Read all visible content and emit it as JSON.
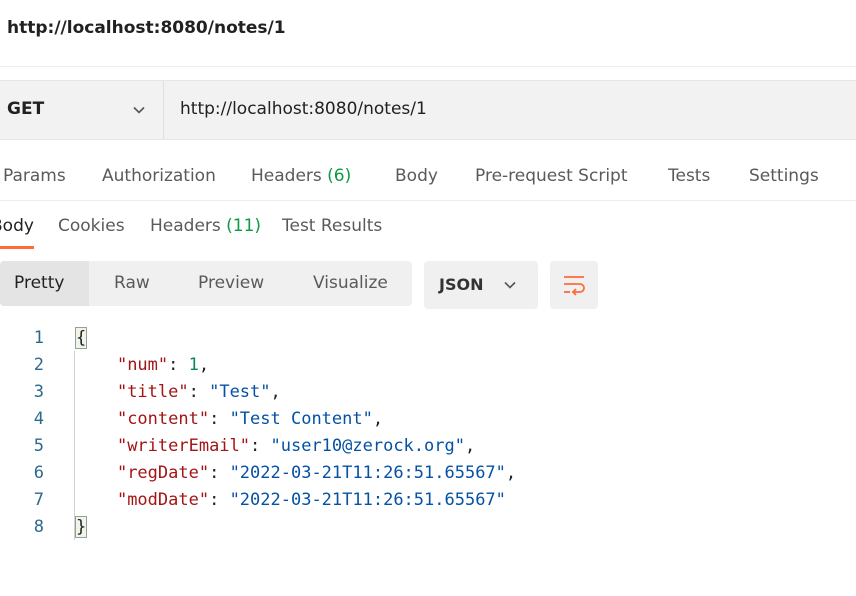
{
  "title": "http://localhost:8080/notes/1",
  "request": {
    "method": "GET",
    "url": "http://localhost:8080/notes/1"
  },
  "request_tabs": {
    "params": "Params",
    "authorization": "Authorization",
    "headers": "Headers",
    "headers_count": "(6)",
    "body": "Body",
    "prerequest": "Pre-request Script",
    "tests": "Tests",
    "settings": "Settings"
  },
  "response_tabs": {
    "body": "Body",
    "cookies": "Cookies",
    "headers": "Headers",
    "headers_count": "(11)",
    "test_results": "Test Results"
  },
  "view_modes": {
    "pretty": "Pretty",
    "raw": "Raw",
    "preview": "Preview",
    "visualize": "Visualize"
  },
  "format": "JSON",
  "colors": {
    "accent": "#ff6c37",
    "count": "#0c9a43"
  },
  "response_body": {
    "line_numbers": [
      "1",
      "2",
      "3",
      "4",
      "5",
      "6",
      "7",
      "8"
    ],
    "open_brace": "{",
    "close_brace": "}",
    "fields": [
      {
        "key": "\"num\"",
        "value": "1",
        "trail": ","
      },
      {
        "key": "\"title\"",
        "value": "\"Test\"",
        "trail": ","
      },
      {
        "key": "\"content\"",
        "value": "\"Test Content\"",
        "trail": ","
      },
      {
        "key": "\"writerEmail\"",
        "value": "\"user10@zerock.org\"",
        "trail": ","
      },
      {
        "key": "\"regDate\"",
        "value": "\"2022-03-21T11:26:51.65567\"",
        "trail": ","
      },
      {
        "key": "\"modDate\"",
        "value": "\"2022-03-21T11:26:51.65567\"",
        "trail": ""
      }
    ]
  }
}
